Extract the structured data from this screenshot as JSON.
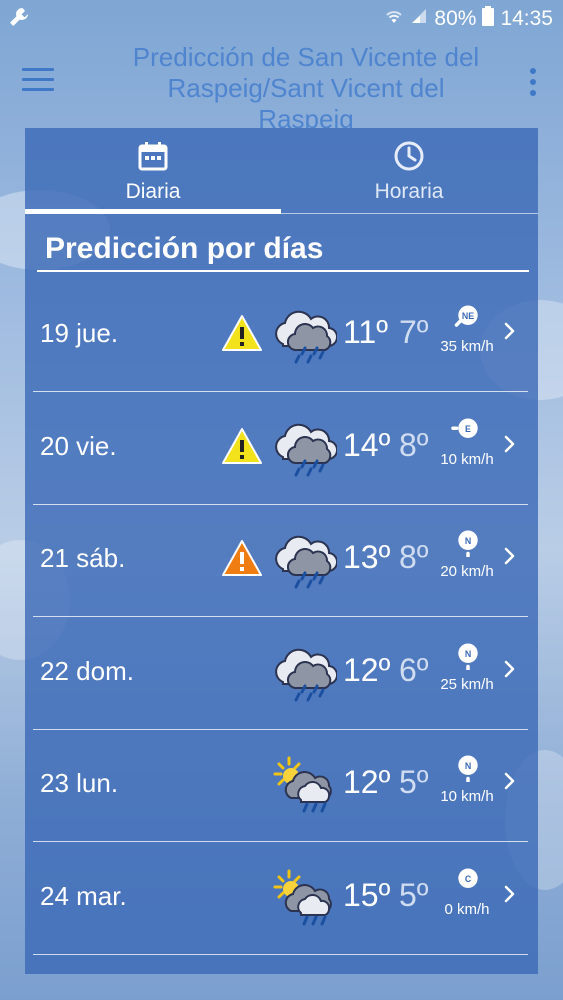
{
  "status_bar": {
    "battery_percent": "80%",
    "time": "14:35"
  },
  "app_bar": {
    "title": "Predicción de San Vicente del Raspeig/Sant Vicent del Raspeig"
  },
  "tabs": [
    {
      "label": "Diaria",
      "icon": "calendar-icon",
      "selected": true
    },
    {
      "label": "Horaria",
      "icon": "clock-icon",
      "selected": false
    }
  ],
  "section_title": "Predicción por días",
  "days": [
    {
      "day": "19 jue.",
      "warning": "yellow",
      "weather": "rain",
      "tmax": "11º",
      "tmin": "7º",
      "wind_dir": "NE",
      "wind_speed": "35 km/h"
    },
    {
      "day": "20 vie.",
      "warning": "yellow",
      "weather": "rain",
      "tmax": "14º",
      "tmin": "8º",
      "wind_dir": "E",
      "wind_speed": "10 km/h"
    },
    {
      "day": "21 sáb.",
      "warning": "orange",
      "weather": "rain",
      "tmax": "13º",
      "tmin": "8º",
      "wind_dir": "N",
      "wind_speed": "20 km/h"
    },
    {
      "day": "22 dom.",
      "warning": null,
      "weather": "rain",
      "tmax": "12º",
      "tmin": "6º",
      "wind_dir": "N",
      "wind_speed": "25 km/h"
    },
    {
      "day": "23 lun.",
      "warning": null,
      "weather": "sun-cloud-rain",
      "tmax": "12º",
      "tmin": "5º",
      "wind_dir": "N",
      "wind_speed": "10 km/h"
    },
    {
      "day": "24 mar.",
      "warning": null,
      "weather": "sun-cloud-rain",
      "tmax": "15º",
      "tmin": "5º",
      "wind_dir": "C",
      "wind_speed": "0 km/h"
    }
  ],
  "colors": {
    "panel": "#3b69b6",
    "title": "#4f84cf",
    "warning_yellow": "#f2e21b",
    "warning_orange": "#ef7d12"
  }
}
